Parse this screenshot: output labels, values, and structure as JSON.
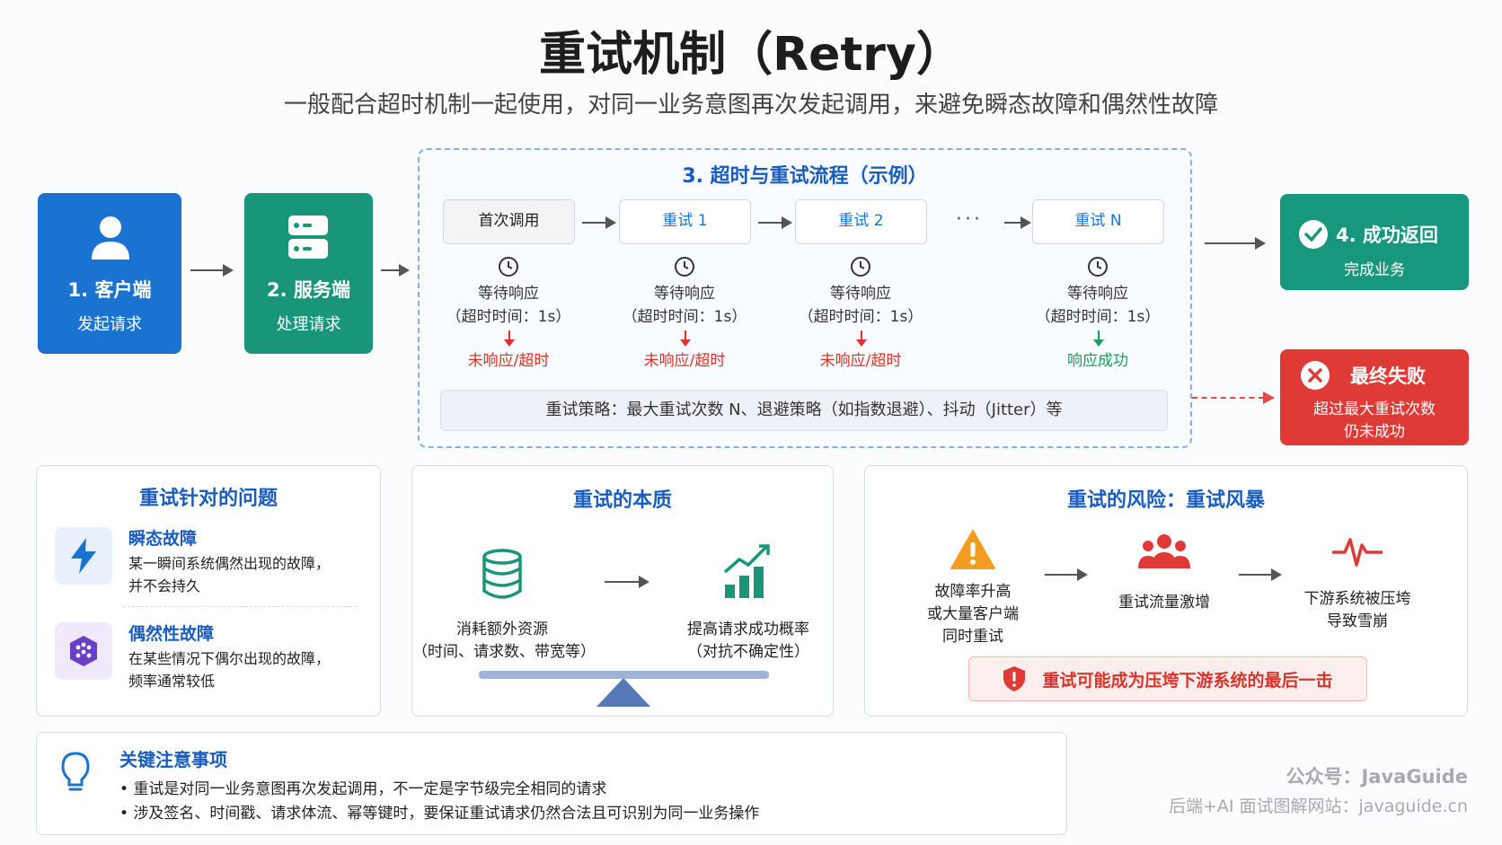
{
  "title": "重试机制（Retry）",
  "subtitle": "一般配合超时机制一起使用，对同一业务意图再次发起调用，来避免瞬态故障和偶然性故障",
  "client": {
    "main": "1. 客户端",
    "sub": "发起请求"
  },
  "server": {
    "main": "2. 服务端",
    "sub": "处理请求"
  },
  "process": {
    "title": "3. 超时与重试流程（示例）",
    "ellipsis": "···",
    "steps": [
      {
        "label": "首次调用",
        "wait": "等待响应",
        "timeout": "（超时时间：1s）",
        "result": "未响应/超时"
      },
      {
        "label": "重试 1",
        "wait": "等待响应",
        "timeout": "（超时时间：1s）",
        "result": "未响应/超时"
      },
      {
        "label": "重试 2",
        "wait": "等待响应",
        "timeout": "（超时时间：1s）",
        "result": "未响应/超时"
      },
      {
        "label": "重试 N",
        "wait": "等待响应",
        "timeout": "（超时时间：1s）",
        "result": "响应成功"
      }
    ],
    "strategy": "重试策略：最大重试次数 N、退避策略（如指数退避）、抖动（Jitter）等"
  },
  "success": {
    "main": "4. 成功返回",
    "sub": "完成业务"
  },
  "failure": {
    "main": "最终失败",
    "sub1": "超过最大重试次数",
    "sub2": "仍未成功"
  },
  "problems": {
    "title": "重试针对的问题",
    "items": [
      {
        "head": "瞬态故障",
        "line1": "某一瞬间系统偶然出现的故障，",
        "line2": "并不会持久"
      },
      {
        "head": "偶然性故障",
        "line1": "在某些情况下偶尔出现的故障，",
        "line2": "频率通常较低"
      }
    ]
  },
  "essence": {
    "title": "重试的本质",
    "left": {
      "line1": "消耗额外资源",
      "line2": "（时间、请求数、带宽等）"
    },
    "right": {
      "line1": "提高请求成功概率",
      "line2": "（对抗不确定性）"
    }
  },
  "risk": {
    "title": "重试的风险：重试风暴",
    "steps": [
      {
        "line1": "故障率升高",
        "line2": "或大量客户端",
        "line3": "同时重试"
      },
      {
        "line1": "重试流量激增"
      },
      {
        "line1": "下游系统被压垮",
        "line2": "导致雪崩"
      }
    ],
    "banner": "重试可能成为压垮下游系统的最后一击"
  },
  "notes": {
    "title": "关键注意事项",
    "items": [
      "重试是对同一业务意图再次发起调用，不一定是字节级完全相同的请求",
      "涉及签名、时间戳、请求体流、幂等键时，要保证重试请求仍然合法且可识别为同一业务操作"
    ]
  },
  "watermark": {
    "line1": "公众号：JavaGuide",
    "line2": "后端+AI 面试图解网站：javaguide.cn"
  },
  "colors": {
    "blue": "#1a73d1",
    "teal": "#19967a",
    "red": "#e03a37",
    "title_blue": "#1a5dbf"
  }
}
